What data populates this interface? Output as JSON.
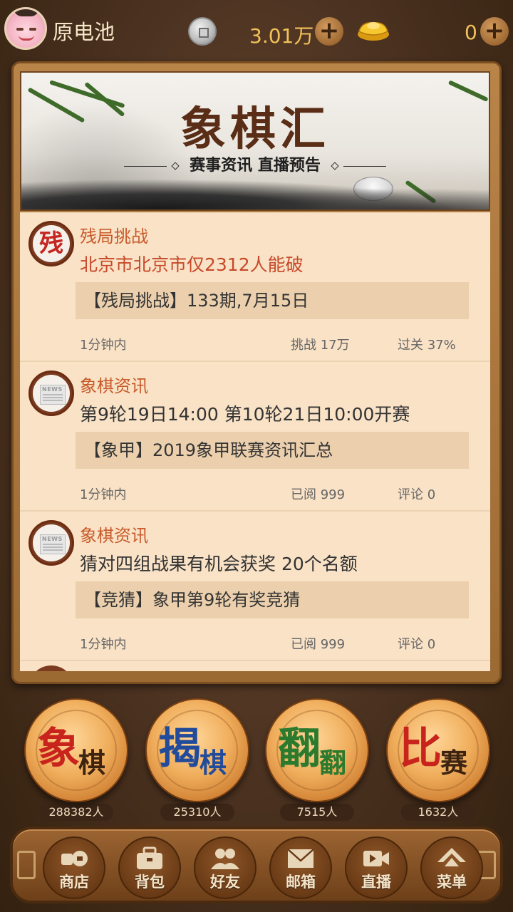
{
  "header": {
    "username": "原电池",
    "coins": "3.01万",
    "gold": "0",
    "icons": [
      "avatar",
      "coin-icon",
      "plus-icon",
      "gold-ingot-icon",
      "plus-icon"
    ]
  },
  "banner": {
    "title": "象棋汇",
    "subtitle": "赛事资讯 直播预告"
  },
  "feed": [
    {
      "category": "残局挑战",
      "badge": "残",
      "headline": "北京市北京市仅2312人能破",
      "tag": "【残局挑战】133期,7月15日",
      "time": "1分钟内",
      "stat1": "挑战 17万",
      "stat2": "过关 37%"
    },
    {
      "category": "象棋资讯",
      "badge": "news-icon",
      "headline": "第9轮19日14:00 第10轮21日10:00开赛",
      "tag": "【象甲】2019象甲联赛资讯汇总",
      "time": "1分钟内",
      "stat1": "已阅 999",
      "stat2": "评论 0"
    },
    {
      "category": "象棋资讯",
      "badge": "news-icon",
      "headline": "猜对四组战果有机会获奖 20个名额",
      "tag": "【竞猜】象甲第9轮有奖竞猜",
      "time": "1分钟内",
      "stat1": "已阅 999",
      "stat2": "评论 0"
    }
  ],
  "games": [
    {
      "big": "象",
      "small": "棋",
      "count": "288382人"
    },
    {
      "big": "揭",
      "small": "棋",
      "count": "25310人"
    },
    {
      "big": "翻",
      "small": "翻",
      "count": "7515人"
    },
    {
      "big": "比",
      "small": "赛",
      "count": "1632人"
    }
  ],
  "nav": [
    {
      "label": "商店",
      "icon": "shop-icon"
    },
    {
      "label": "背包",
      "icon": "bag-icon"
    },
    {
      "label": "好友",
      "icon": "friends-icon"
    },
    {
      "label": "邮箱",
      "icon": "mail-icon"
    },
    {
      "label": "直播",
      "icon": "live-icon"
    },
    {
      "label": "菜单",
      "icon": "menu-icon"
    }
  ],
  "colors": {
    "accent": "#c85a2a",
    "coin_text": "#f1c15a",
    "card_bg": "#f9e2c6"
  }
}
